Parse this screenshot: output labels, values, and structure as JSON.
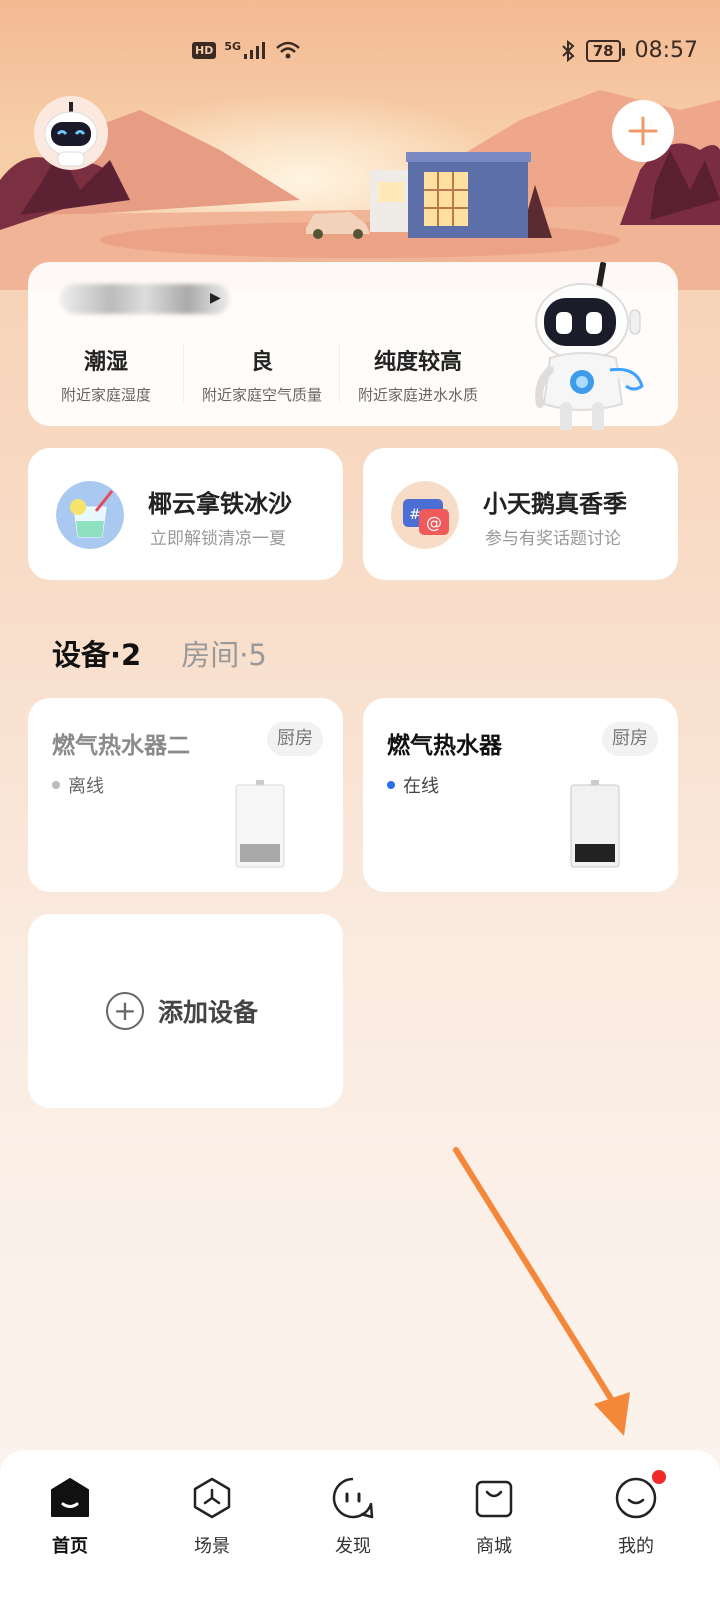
{
  "status_bar": {
    "hd": "HD",
    "network": "5G",
    "battery": "78",
    "time": "08:57"
  },
  "home": {
    "name": "",
    "env": [
      {
        "value": "潮湿",
        "desc": "附近家庭湿度"
      },
      {
        "value": "良",
        "desc": "附近家庭空气质量"
      },
      {
        "value": "纯度较高",
        "desc": "附近家庭进水水质"
      }
    ]
  },
  "promos": [
    {
      "title": "椰云拿铁冰沙",
      "subtitle": "立即解锁清凉一夏"
    },
    {
      "title": "小天鹅真香季",
      "subtitle": "参与有奖话题讨论"
    }
  ],
  "tabs": {
    "devices": "设备·2",
    "rooms": "房间·5"
  },
  "devices": [
    {
      "name": "燃气热水器二",
      "room": "厨房",
      "status": "离线",
      "status_color": "#bbbbbb",
      "name_color": "#8a8a8a"
    },
    {
      "name": "燃气热水器",
      "room": "厨房",
      "status": "在线",
      "status_color": "#2a6ff0",
      "name_color": "#111111"
    }
  ],
  "add_device": {
    "icon": "plus-circle-icon",
    "label": "添加设备"
  },
  "nav": [
    {
      "label": "首页",
      "icon": "home-icon"
    },
    {
      "label": "场景",
      "icon": "scene-icon"
    },
    {
      "label": "发现",
      "icon": "discover-icon"
    },
    {
      "label": "商城",
      "icon": "shop-icon"
    },
    {
      "label": "我的",
      "icon": "profile-icon"
    }
  ],
  "colors": {
    "accent": "#f09a6a",
    "online": "#2a6ff0",
    "notify": "#f02a2a"
  }
}
